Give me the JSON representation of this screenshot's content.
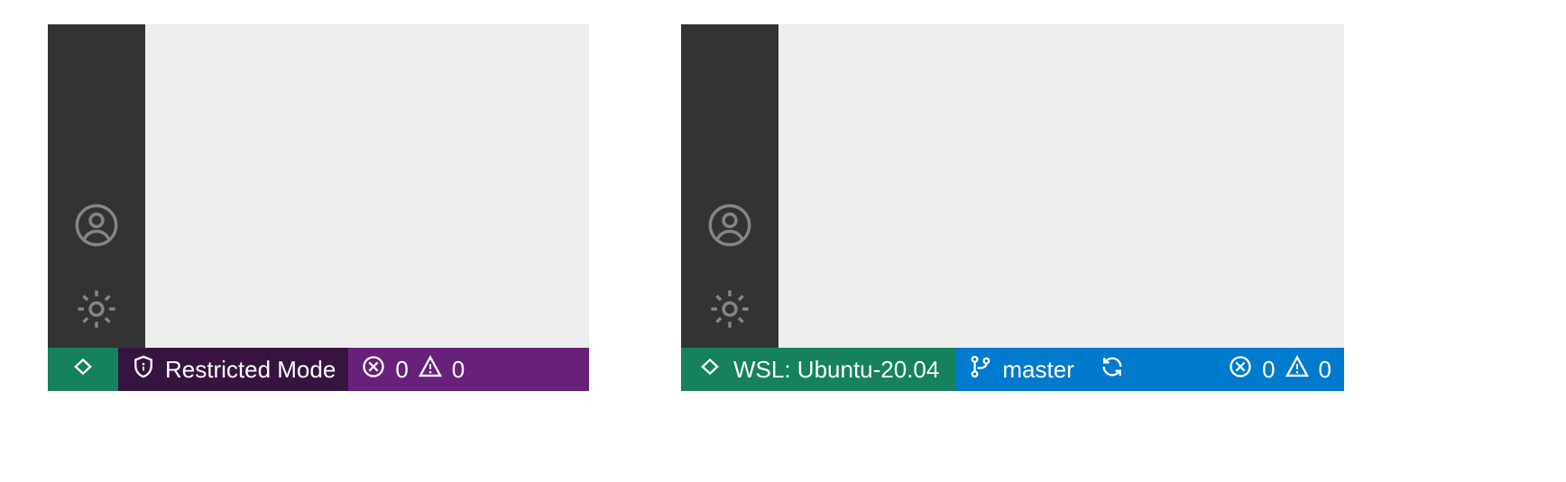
{
  "left": {
    "remote_label": "",
    "restricted_label": "Restricted Mode",
    "errors": "0",
    "warnings": "0"
  },
  "right": {
    "remote_label": "WSL: Ubuntu-20.04",
    "branch": "master",
    "errors": "0",
    "warnings": "0"
  },
  "colors": {
    "activitybar_bg": "#333333",
    "editor_bg": "#eeeeee",
    "remote_bg": "#16825d",
    "left_status_bg": "#68217a",
    "left_restricted_bg": "#37143f",
    "right_status_bg": "#007acc"
  }
}
